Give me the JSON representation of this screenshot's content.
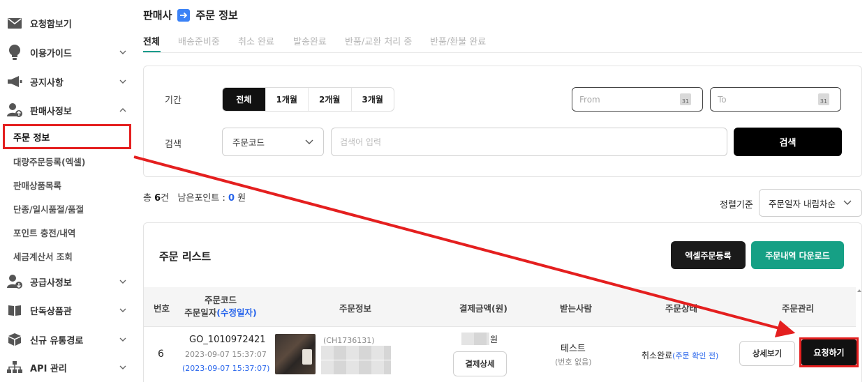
{
  "sidebar": {
    "items": [
      {
        "label": "요청함보기",
        "icon": "mail-icon"
      },
      {
        "label": "이용가이드",
        "icon": "bulb-icon"
      },
      {
        "label": "공지사항",
        "icon": "megaphone-icon"
      },
      {
        "label": "판매사정보",
        "icon": "user-upload-icon"
      },
      {
        "label": "공급사정보",
        "icon": "user-download-icon"
      },
      {
        "label": "단독상품관",
        "icon": "book-icon"
      },
      {
        "label": "신규 유통경로",
        "icon": "box-icon"
      },
      {
        "label": "API 관리",
        "icon": "network-icon"
      }
    ],
    "subitems": [
      "주문 정보",
      "대량주문등록(엑셀)",
      "판매상품목록",
      "단종/일시품절/품절",
      "포인트 충전/내역",
      "세금계산서 조회"
    ]
  },
  "header": {
    "crumb_left": "판매사",
    "crumb_right": "주문 정보",
    "accent": "#3b82f6"
  },
  "tabs": [
    "전체",
    "배송준비중",
    "취소 완료",
    "발송완료",
    "반품/교환 처리 중",
    "반품/환불 완료"
  ],
  "filter": {
    "period_label": "기간",
    "period_options": [
      "전체",
      "1개월",
      "2개월",
      "3개월"
    ],
    "from_placeholder": "From",
    "to_placeholder": "To",
    "calendar_day": "31",
    "search_label": "검색",
    "search_field": "주문코드",
    "search_placeholder": "검색어 입력",
    "search_button": "검색"
  },
  "summary": {
    "total_prefix": "총",
    "total_count": "6",
    "total_unit": "건",
    "points_label": "남은포인트 :",
    "points_value": "0",
    "points_unit": "원",
    "sort_label": "정렬기준",
    "sort_value": "주문일자 내림차순"
  },
  "list": {
    "title": "주문 리스트",
    "excel_button": "엑셀주문등록",
    "download_button": "주문내역 다운로드",
    "accent": "#16a085",
    "columns": {
      "no": "번호",
      "code_line1": "주문코드",
      "code_line2": "주문일자",
      "code_line2_link": "(수정일자)",
      "info": "주문정보",
      "amount": "결제금액(원)",
      "receiver": "받는사람",
      "status": "주문상태",
      "manage": "주문관리"
    },
    "rows": [
      {
        "no": "6",
        "code": "GO_1010972421",
        "date": "2023-09-07 15:37:07",
        "modified": "(2023-09-07 15:37:07)",
        "product_code": "(CH1736131)",
        "amount_unit": "원",
        "pay_detail": "결제상세",
        "receiver": "테스트",
        "receiver_sub": "(번호 없음)",
        "status": "취소완료",
        "status_link": "(주문 확인 전)",
        "detail_button": "상세보기",
        "request_button": "요청하기"
      }
    ]
  }
}
